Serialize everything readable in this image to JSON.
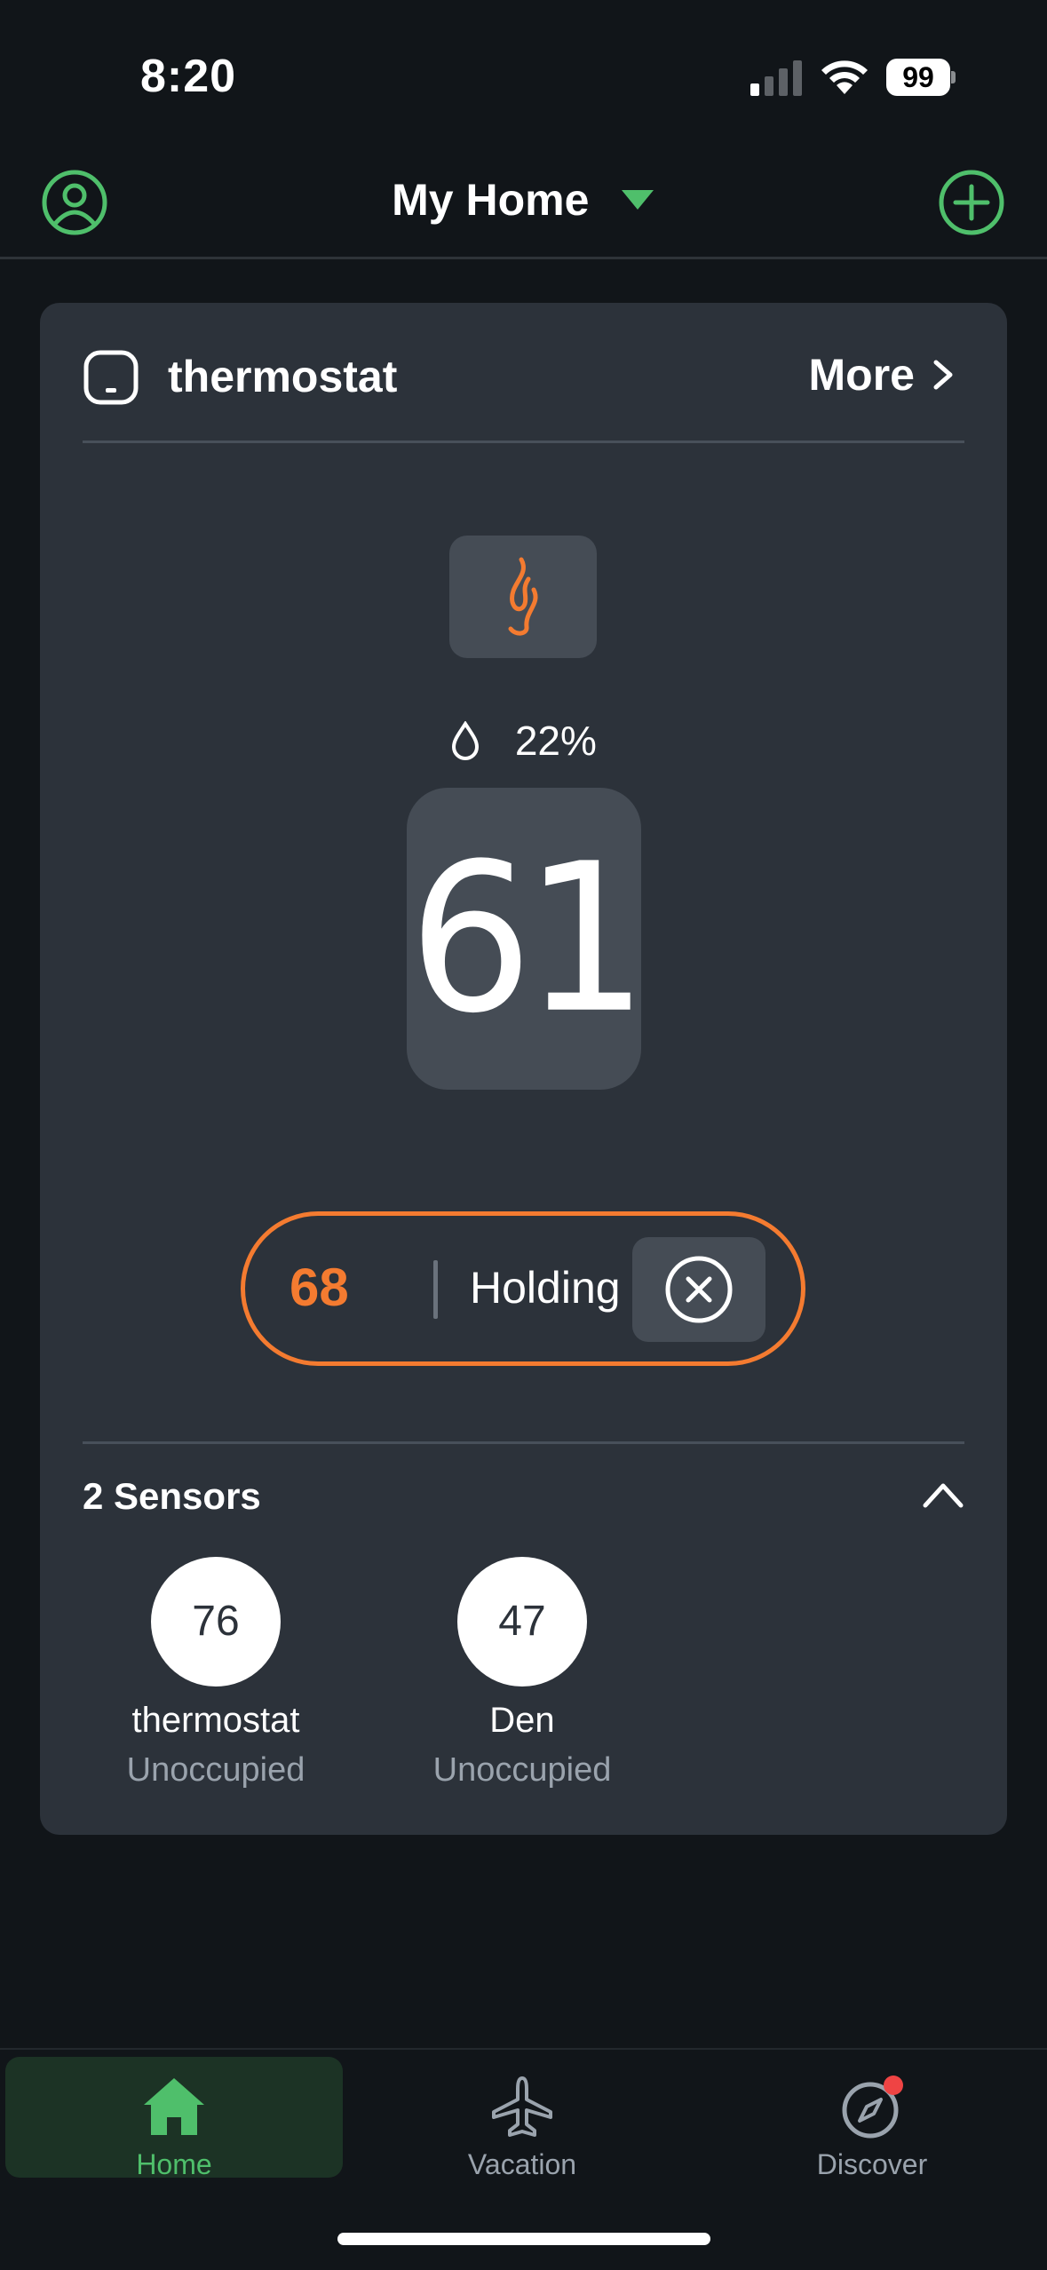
{
  "status_bar": {
    "time": "8:20",
    "battery": "99"
  },
  "header": {
    "title": "My Home",
    "profile_icon": "person-circle-icon",
    "add_icon": "plus-circle-icon",
    "accent": "#4fbf6b"
  },
  "thermostat": {
    "name": "thermostat",
    "more_label": "More",
    "mode_icon": "flame-icon",
    "humidity": "22%",
    "current_temp": "61",
    "hold": {
      "setpoint": "68",
      "label": "Holding",
      "accent": "#f47b30"
    }
  },
  "sensors": {
    "title": "2 Sensors",
    "items": [
      {
        "temp": "76",
        "name": "thermostat",
        "status": "Unoccupied"
      },
      {
        "temp": "47",
        "name": "Den",
        "status": "Unoccupied"
      }
    ]
  },
  "tabbar": {
    "tabs": [
      {
        "label": "Home",
        "icon": "house-icon",
        "active": true
      },
      {
        "label": "Vacation",
        "icon": "airplane-icon",
        "active": false
      },
      {
        "label": "Discover",
        "icon": "compass-icon",
        "active": false
      }
    ]
  }
}
